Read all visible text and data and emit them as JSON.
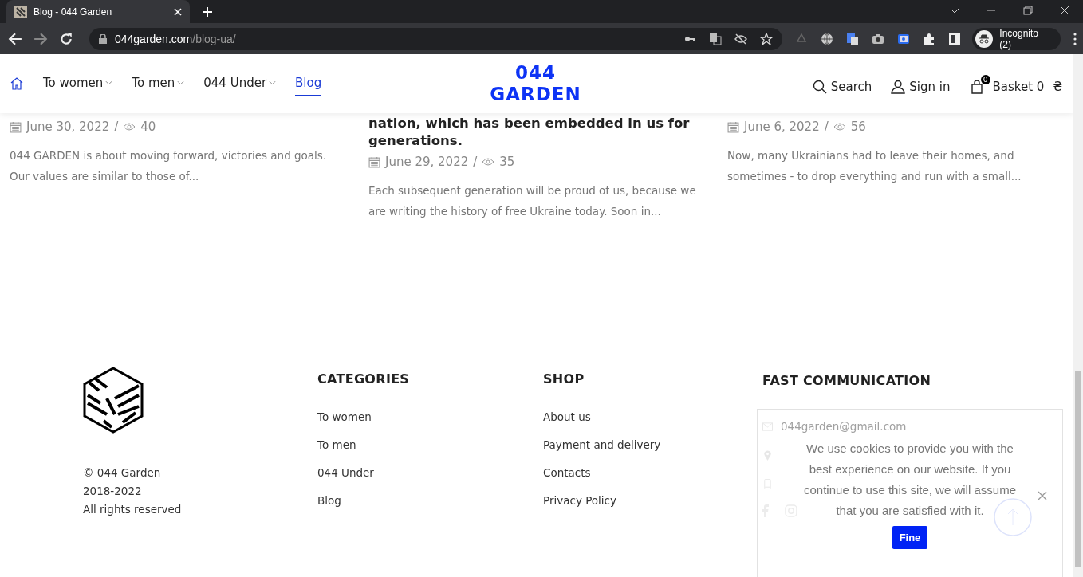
{
  "browser": {
    "tab_title": "Blog - 044 Garden",
    "url_host": "044garden.com",
    "url_path": "/blog-ua/",
    "profile": "Incognito (2)"
  },
  "header": {
    "nav": [
      {
        "label": "To women",
        "dropdown": true,
        "selected": false
      },
      {
        "label": "To men",
        "dropdown": true,
        "selected": false
      },
      {
        "label": "044 Under",
        "dropdown": true,
        "selected": false
      },
      {
        "label": "Blog",
        "dropdown": false,
        "selected": true
      }
    ],
    "logo": [
      "044",
      "GARDEN"
    ],
    "search": "Search",
    "sign_in": "Sign in",
    "basket": "Basket 0",
    "currency": "₴",
    "basket_count": "0"
  },
  "posts": [
    {
      "date": "June 30, 2022",
      "separator": "/",
      "views": "40",
      "excerpt": "044 GARDEN is about moving forward, victories and goals. Our values are similar to those of..."
    },
    {
      "title_lines": [
        "nation, which has been embedded in us for",
        "generations."
      ],
      "date": "June 29, 2022",
      "separator": "/",
      "views": "35",
      "excerpt": "Each subsequent generation will be proud of us, because we are writing the history of free Ukraine today. Soon in..."
    },
    {
      "date": "June 6, 2022",
      "separator": "/",
      "views": "56",
      "excerpt": "Now, many Ukrainians had to leave their homes, and sometimes - to drop everything and run with a small..."
    }
  ],
  "footer": {
    "copyright": [
      "© 044 Garden",
      "2018-2022",
      "All rights reserved"
    ],
    "categories": {
      "title": "CATEGORIES",
      "links": [
        "To women",
        "To men",
        "044 Under",
        "Blog"
      ]
    },
    "shop": {
      "title": "SHOP",
      "links": [
        "About us",
        "Payment and delivery",
        "Contacts",
        "Privacy Policy"
      ]
    },
    "contact": {
      "title": "FAST COMMUNICATION",
      "items": [
        {
          "kind": "email",
          "text": "044garden@gmail.com"
        },
        {
          "kind": "address"
        },
        {
          "kind": "phone"
        }
      ]
    }
  },
  "cookie": {
    "text": "We use cookies to provide you with the best experience on our website. If you continue to use this site, we will assume that you are satisfied with it.",
    "button": "Fine"
  }
}
